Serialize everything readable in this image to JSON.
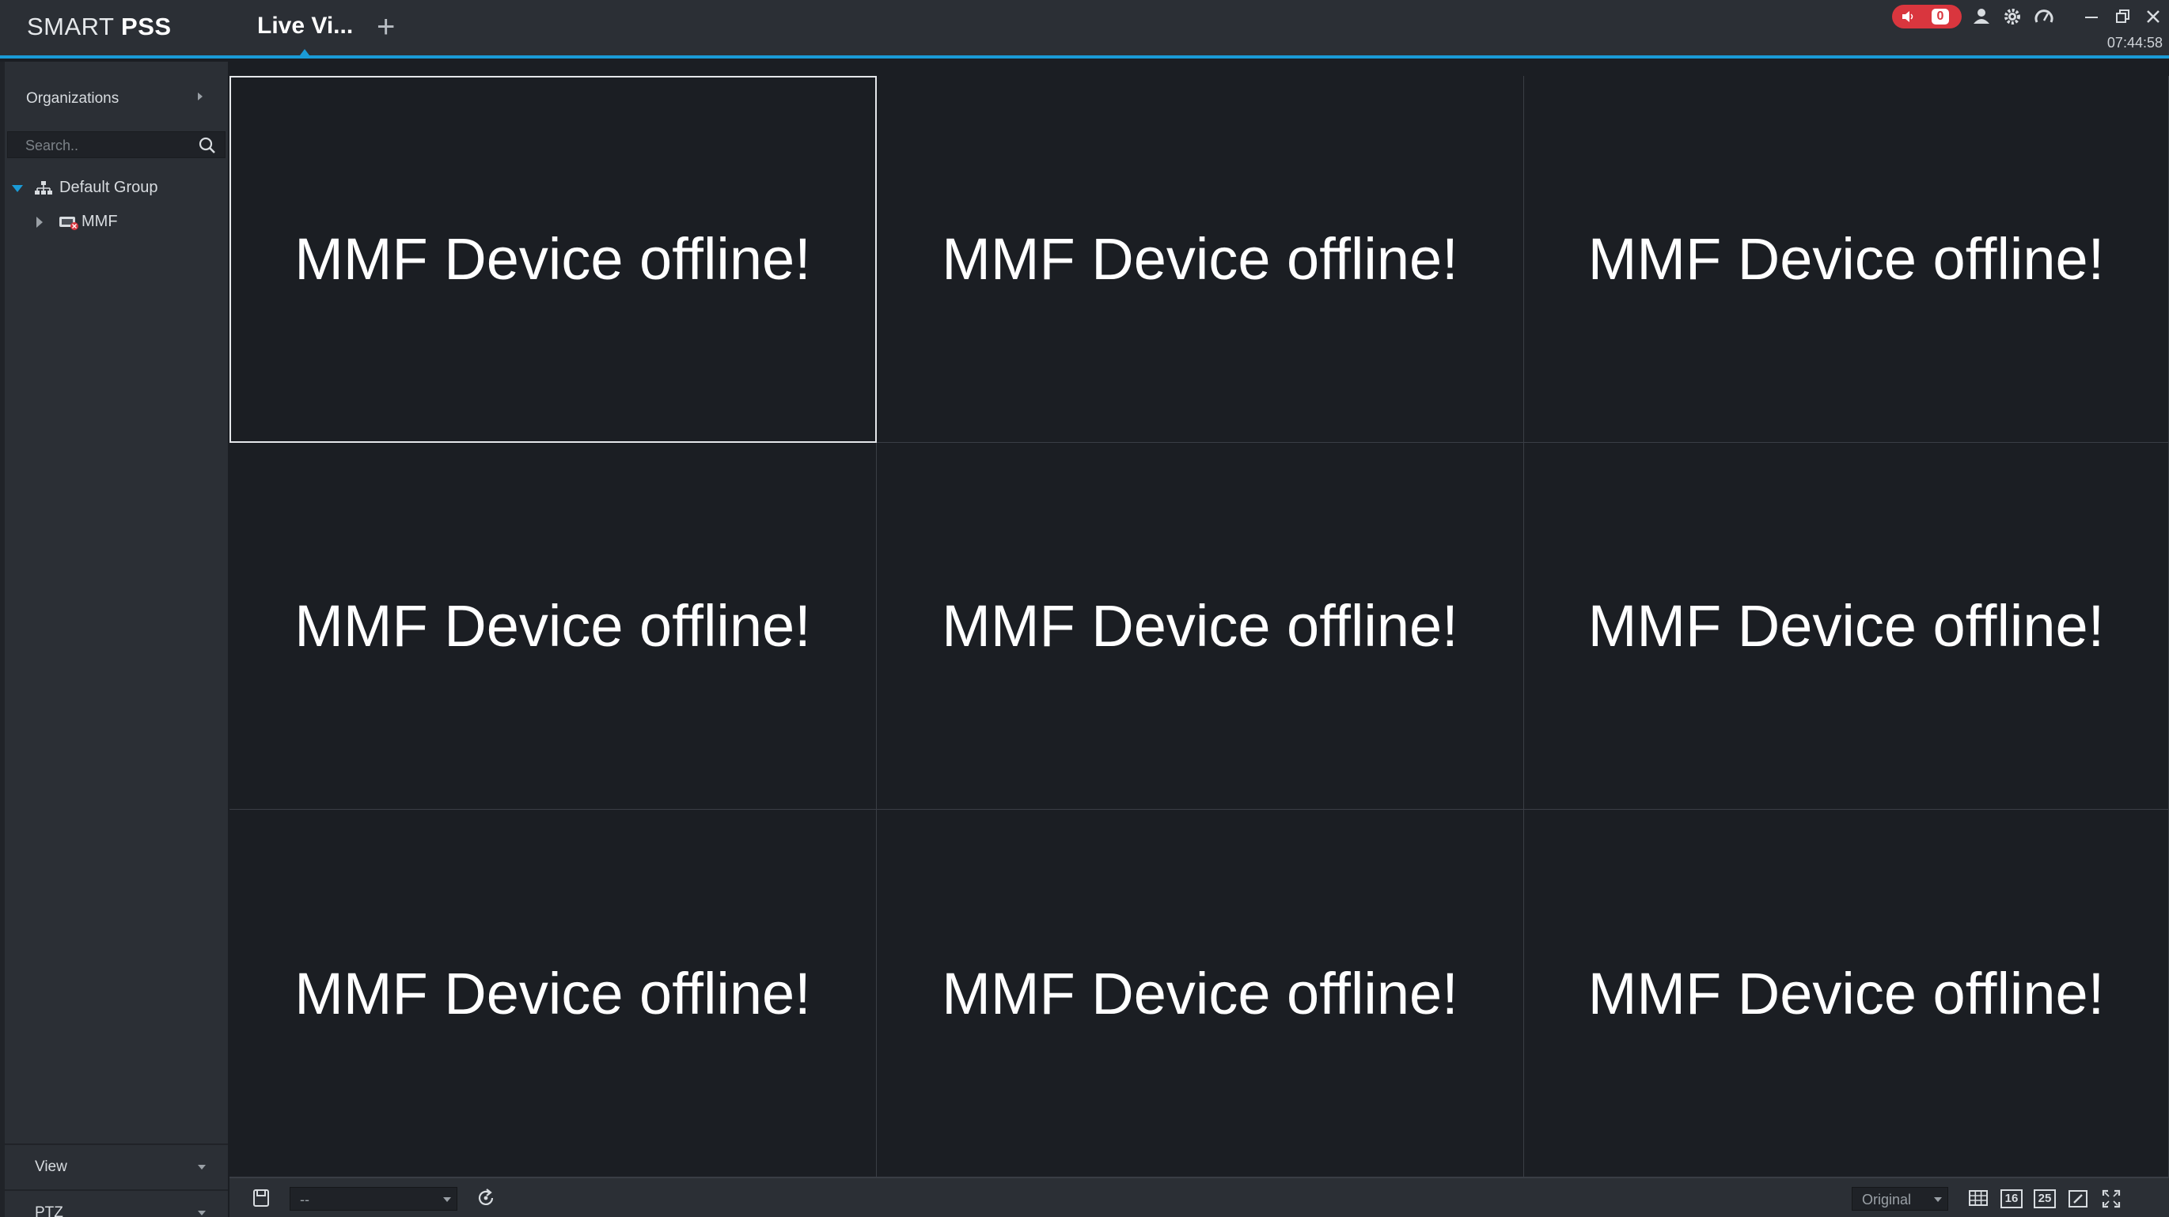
{
  "app": {
    "logo_prefix": "SMART",
    "logo_suffix": "PSS",
    "active_tab": "Live Vi...",
    "add_tab": "+",
    "alarm_count": "0",
    "clock": "07:44:58",
    "accent_color": "#1a9bd7",
    "alarm_color": "#d9363e"
  },
  "sidebar": {
    "section_title": "Organizations",
    "search_placeholder": "Search..",
    "tree": {
      "group_label": "Default Group",
      "device_label": "MMF"
    },
    "view_label": "View",
    "ptz_label": "PTZ"
  },
  "grid": {
    "layout": "3x3",
    "selected_index": 0,
    "cells": [
      "MMF Device offline!",
      "MMF Device offline!",
      "MMF Device offline!",
      "MMF Device offline!",
      "MMF Device offline!",
      "MMF Device offline!",
      "MMF Device offline!",
      "MMF Device offline!",
      "MMF Device offline!"
    ]
  },
  "bottombar": {
    "view_select_value": "--",
    "stream_select_value": "Original",
    "layout_16_label": "16",
    "layout_25_label": "25"
  }
}
